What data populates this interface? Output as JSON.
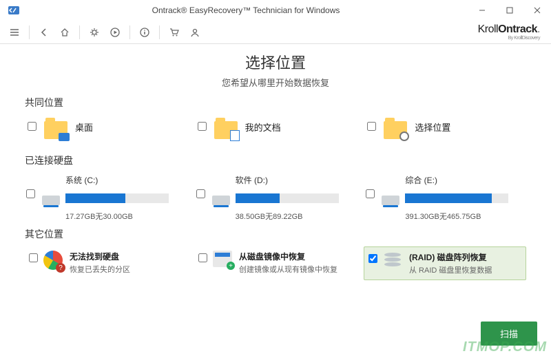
{
  "window": {
    "title": "Ontrack® EasyRecovery™ Technician for Windows"
  },
  "brand": {
    "part1": "Kroll",
    "part2": "Ontrack",
    "sub": "By KrollDiscovery"
  },
  "header": {
    "title": "选择位置",
    "subtitle": "您希望从哪里开始数据恢复"
  },
  "sections": {
    "common": {
      "title": "共同位置"
    },
    "drives": {
      "title": "已连接硬盘"
    },
    "other": {
      "title": "其它位置"
    }
  },
  "common_items": [
    {
      "label": "桌面"
    },
    {
      "label": "我的文档"
    },
    {
      "label": "选择位置"
    }
  ],
  "drives_items": [
    {
      "name": "系统 (C:)",
      "size": "17.27GB无30.00GB",
      "fill_pct": 58
    },
    {
      "name": "软件 (D:)",
      "size": "38.50GB无89.22GB",
      "fill_pct": 43
    },
    {
      "name": "综合 (E:)",
      "size": "391.30GB无465.75GB",
      "fill_pct": 84
    }
  ],
  "other_items": [
    {
      "title": "无法找到硬盘",
      "desc": "恢复已丢失的分区",
      "checked": false
    },
    {
      "title": "从磁盘镜像中恢复",
      "desc": "创建镜像或从现有镜像中恢复",
      "checked": false
    },
    {
      "title": "(RAID) 磁盘阵列恢复",
      "desc": "从 RAID 磁盘里恢复数据",
      "checked": true
    }
  ],
  "footer": {
    "scan": "扫描"
  },
  "watermark": "ITMOP.COM"
}
